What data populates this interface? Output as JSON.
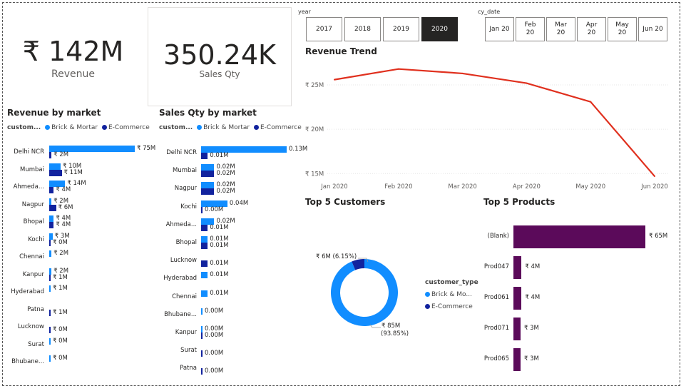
{
  "kpis": {
    "revenue": {
      "value": "₹ 142M",
      "label": "Revenue"
    },
    "sales_qty": {
      "value": "350.24K",
      "label": "Sales Qty"
    }
  },
  "legend": {
    "title": "custom...",
    "items": [
      {
        "label": "Brick & Mortar",
        "color": "#118dff"
      },
      {
        "label": "E-Commerce",
        "color": "#12239e"
      }
    ]
  },
  "revenue_by_market": {
    "title": "Revenue by market",
    "rows": [
      {
        "market": "Delhi NCR",
        "bm": 75,
        "bm_label": "₹ 75M",
        "ec": 2,
        "ec_label": "₹ 2M"
      },
      {
        "market": "Mumbai",
        "bm": 10,
        "bm_label": "₹ 10M",
        "ec": 11,
        "ec_label": "₹ 11M"
      },
      {
        "market": "Ahmeda...",
        "bm": 14,
        "bm_label": "₹ 14M",
        "ec": 4,
        "ec_label": "₹ 4M"
      },
      {
        "market": "Nagpur",
        "bm": 2,
        "bm_label": "₹ 2M",
        "ec": 6,
        "ec_label": "₹ 6M"
      },
      {
        "market": "Bhopal",
        "bm": 4,
        "bm_label": "₹ 4M",
        "ec": 4,
        "ec_label": "₹ 4M"
      },
      {
        "market": "Kochi",
        "bm": 3,
        "bm_label": "₹ 3M",
        "ec": 0,
        "ec_label": "₹ 0M"
      },
      {
        "market": "Chennai",
        "bm": 2,
        "bm_label": "₹ 2M",
        "ec": null,
        "ec_label": ""
      },
      {
        "market": "Kanpur",
        "bm": 2,
        "bm_label": "₹ 2M",
        "ec": 1,
        "ec_label": "₹ 1M"
      },
      {
        "market": "Hyderabad",
        "bm": 1,
        "bm_label": "₹ 1M",
        "ec": null,
        "ec_label": ""
      },
      {
        "market": "Patna",
        "bm": null,
        "bm_label": "",
        "ec": 1,
        "ec_label": "₹ 1M"
      },
      {
        "market": "Lucknow",
        "bm": null,
        "bm_label": "",
        "ec": 0,
        "ec_label": "₹ 0M"
      },
      {
        "market": "Surat",
        "bm": 0,
        "bm_label": "₹ 0M",
        "ec": null,
        "ec_label": ""
      },
      {
        "market": "Bhubane...",
        "bm": 0,
        "bm_label": "₹ 0M",
        "ec": null,
        "ec_label": ""
      }
    ]
  },
  "sales_by_market": {
    "title": "Sales Qty by market",
    "rows": [
      {
        "market": "Delhi NCR",
        "bm": 0.13,
        "bm_label": "0.13M",
        "ec": 0.01,
        "ec_label": "0.01M"
      },
      {
        "market": "Mumbai",
        "bm": 0.02,
        "bm_label": "0.02M",
        "ec": 0.02,
        "ec_label": "0.02M"
      },
      {
        "market": "Nagpur",
        "bm": 0.02,
        "bm_label": "0.02M",
        "ec": 0.02,
        "ec_label": "0.02M"
      },
      {
        "market": "Kochi",
        "bm": 0.04,
        "bm_label": "0.04M",
        "ec": 0.0,
        "ec_label": "0.00M"
      },
      {
        "market": "Ahmeda...",
        "bm": 0.02,
        "bm_label": "0.02M",
        "ec": 0.01,
        "ec_label": "0.01M"
      },
      {
        "market": "Bhopal",
        "bm": 0.01,
        "bm_label": "0.01M",
        "ec": 0.01,
        "ec_label": "0.01M"
      },
      {
        "market": "Lucknow",
        "bm": null,
        "bm_label": "",
        "ec": 0.01,
        "ec_label": "0.01M"
      },
      {
        "market": "Hyderabad",
        "bm": 0.01,
        "bm_label": "0.01M",
        "ec": null,
        "ec_label": ""
      },
      {
        "market": "Chennai",
        "bm": 0.01,
        "bm_label": "0.01M",
        "ec": null,
        "ec_label": ""
      },
      {
        "market": "Bhubane...",
        "bm": 0.0,
        "bm_label": "0.00M",
        "ec": null,
        "ec_label": ""
      },
      {
        "market": "Kanpur",
        "bm": 0.0,
        "bm_label": "0.00M",
        "ec": 0.0,
        "ec_label": "0.00M"
      },
      {
        "market": "Surat",
        "bm": null,
        "bm_label": "",
        "ec": 0.0,
        "ec_label": "0.00M"
      },
      {
        "market": "Patna",
        "bm": null,
        "bm_label": "",
        "ec": 0.0,
        "ec_label": "0.00M"
      }
    ]
  },
  "year_slicer": {
    "label": "year",
    "options": [
      "2017",
      "2018",
      "2019",
      "2020"
    ],
    "selected": "2020"
  },
  "date_slicer": {
    "label": "cy_date",
    "options": [
      [
        "Jan 20"
      ],
      [
        "Feb",
        "20"
      ],
      [
        "Mar",
        "20"
      ],
      [
        "Apr",
        "20"
      ],
      [
        "May",
        "20"
      ],
      [
        "Jun 20"
      ]
    ]
  },
  "chart_data": [
    {
      "type": "line",
      "title": "Revenue Trend",
      "x": [
        "Jan 2020",
        "Feb 2020",
        "Mar 2020",
        "Apr 2020",
        "May 2020",
        "Jun 2020"
      ],
      "values": [
        25.6,
        26.8,
        26.3,
        25.2,
        23.1,
        14.7
      ],
      "yticks": [
        {
          "v": 15,
          "label": "₹ 15M"
        },
        {
          "v": 20,
          "label": "₹ 20M"
        },
        {
          "v": 25,
          "label": "₹ 25M"
        }
      ],
      "ylim": [
        14.3,
        27.5
      ],
      "color": "#e0301e",
      "grid": true
    },
    {
      "type": "pie",
      "title": "Top 5 Customers",
      "legend_title": "customer_type",
      "slices": [
        {
          "name": "Brick & Mo...",
          "value": 93.85,
          "label": "₹ 85M",
          "pct": "(93.85%)",
          "color": "#118dff"
        },
        {
          "name": "E-Commerce",
          "value": 6.15,
          "label": "₹ 6M (6.15%)",
          "pct": "",
          "color": "#12239e"
        }
      ]
    },
    {
      "type": "bar",
      "title": "Top 5 Products",
      "categories": [
        "(Blank)",
        "Prod047",
        "Prod061",
        "Prod071",
        "Prod065"
      ],
      "values": [
        65,
        4,
        4,
        3,
        3
      ],
      "labels": [
        "₹ 65M",
        "₹ 4M",
        "₹ 4M",
        "₹ 3M",
        "₹ 3M"
      ],
      "color": "#5b0a5a"
    }
  ]
}
